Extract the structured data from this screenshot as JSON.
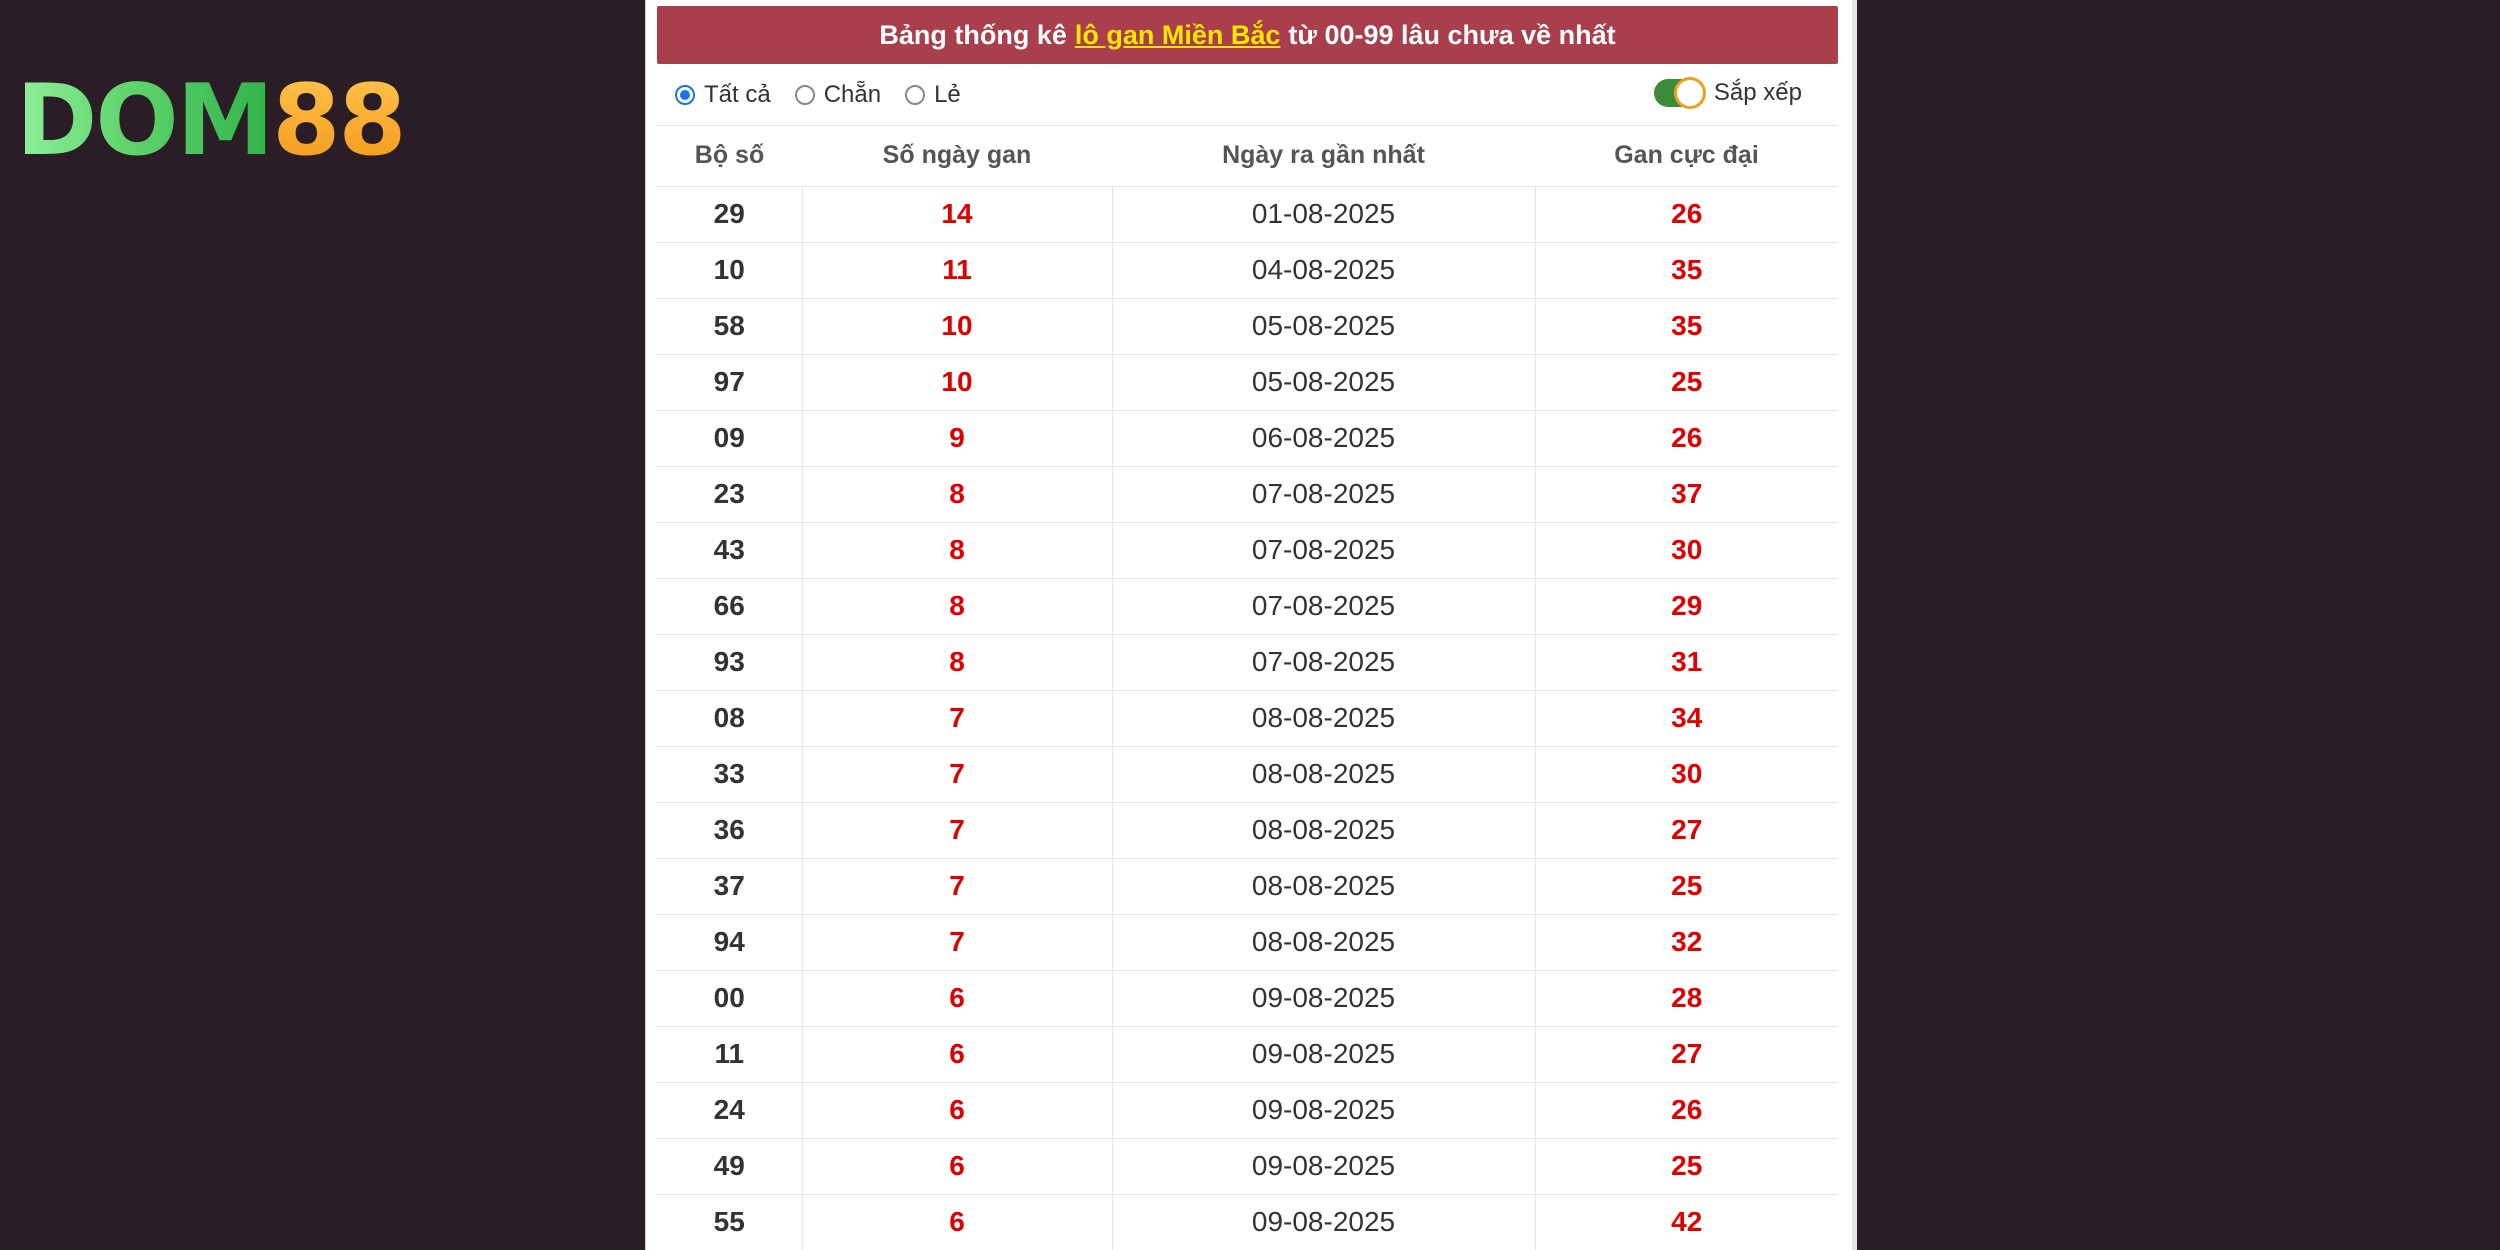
{
  "logo": {
    "part1": "DOM",
    "part2": "88"
  },
  "header": {
    "prefix": "Bảng thống kê",
    "highlight": "lô gan Miền Bắc",
    "suffix": "từ 00-99 lâu chưa về nhất"
  },
  "filters": {
    "options": [
      "Tất cả",
      "Chẵn",
      "Lẻ"
    ],
    "selected": "Tất cả",
    "toggle_label": "Sắp xếp",
    "toggle_on": true
  },
  "table": {
    "columns": [
      "Bộ số",
      "Số ngày gan",
      "Ngày ra gần nhất",
      "Gan cực đại"
    ],
    "rows": [
      [
        "29",
        "14",
        "01-08-2025",
        "26"
      ],
      [
        "10",
        "11",
        "04-08-2025",
        "35"
      ],
      [
        "58",
        "10",
        "05-08-2025",
        "35"
      ],
      [
        "97",
        "10",
        "05-08-2025",
        "25"
      ],
      [
        "09",
        "9",
        "06-08-2025",
        "26"
      ],
      [
        "23",
        "8",
        "07-08-2025",
        "37"
      ],
      [
        "43",
        "8",
        "07-08-2025",
        "30"
      ],
      [
        "66",
        "8",
        "07-08-2025",
        "29"
      ],
      [
        "93",
        "8",
        "07-08-2025",
        "31"
      ],
      [
        "08",
        "7",
        "08-08-2025",
        "34"
      ],
      [
        "33",
        "7",
        "08-08-2025",
        "30"
      ],
      [
        "36",
        "7",
        "08-08-2025",
        "27"
      ],
      [
        "37",
        "7",
        "08-08-2025",
        "25"
      ],
      [
        "94",
        "7",
        "08-08-2025",
        "32"
      ],
      [
        "00",
        "6",
        "09-08-2025",
        "28"
      ],
      [
        "11",
        "6",
        "09-08-2025",
        "27"
      ],
      [
        "24",
        "6",
        "09-08-2025",
        "26"
      ],
      [
        "49",
        "6",
        "09-08-2025",
        "25"
      ],
      [
        "55",
        "6",
        "09-08-2025",
        "42"
      ]
    ]
  },
  "colors": {
    "background": "#2a1d26",
    "header_bg": "#a93f4c",
    "highlight": "#ffe600",
    "value_red": "#e00000"
  }
}
